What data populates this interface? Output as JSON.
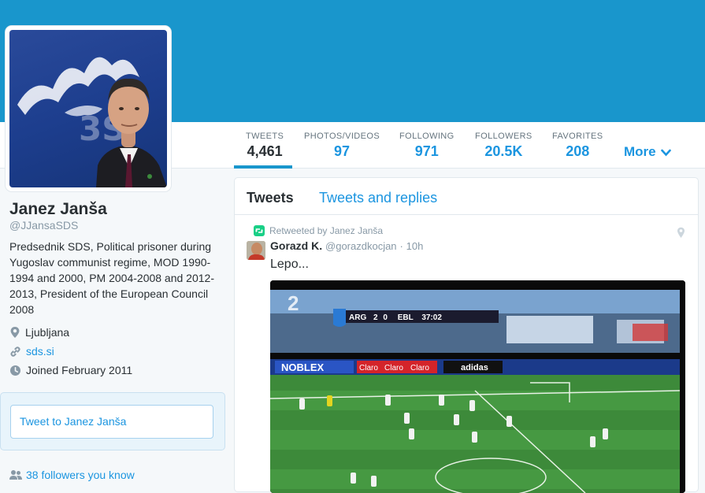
{
  "colors": {
    "banner": "#1996cc",
    "link": "#1b95e0",
    "text": "#292f33",
    "muted": "#8899a6",
    "retweet": "#19cf86"
  },
  "nav": {
    "stats": [
      {
        "label": "TWEETS",
        "value": "4,461"
      },
      {
        "label": "PHOTOS/VIDEOS",
        "value": "97"
      },
      {
        "label": "FOLLOWING",
        "value": "971"
      },
      {
        "label": "FOLLOWERS",
        "value": "20.5K"
      },
      {
        "label": "FAVORITES",
        "value": "208"
      }
    ],
    "more_label": "More",
    "active_stat": "TWEETS"
  },
  "profile": {
    "name": "Janez Janša",
    "handle": "@JJansaSDS",
    "bio": "Predsednik SDS, Political prisoner during Yugoslav communist regime, MOD 1990-1994 and 2000, PM 2004-2008 and 2012-2013, President of the European Council 2008",
    "location": "Ljubljana",
    "url": "sds.si",
    "joined": "Joined February 2011",
    "location_icon": "map-pin-icon",
    "url_icon": "link-icon",
    "joined_icon": "clock-icon"
  },
  "tweet_box": {
    "placeholder": "Tweet to Janez Janša"
  },
  "followers_you_know": "38 followers you know",
  "timeline": {
    "tabs": [
      {
        "label": "Tweets",
        "active": true
      },
      {
        "label": "Tweets and replies",
        "active": false
      }
    ],
    "tweet": {
      "retweet_label": "Retweeted by Janez Janša",
      "name": "Gorazd K.",
      "handle": "@gorazdkocjan",
      "separator": "·",
      "time": "10h",
      "text": "Lepo...",
      "media": {
        "description_icon": "football-match-photo",
        "scoreboard": {
          "team1": "ARG",
          "score1": "2",
          "score2": "0",
          "team2": "EBL",
          "clock": "37:02"
        },
        "ads": [
          "NOBLEX",
          "Claro",
          "Claro",
          "Claro",
          "adidas"
        ],
        "channel_number": "2"
      }
    }
  }
}
